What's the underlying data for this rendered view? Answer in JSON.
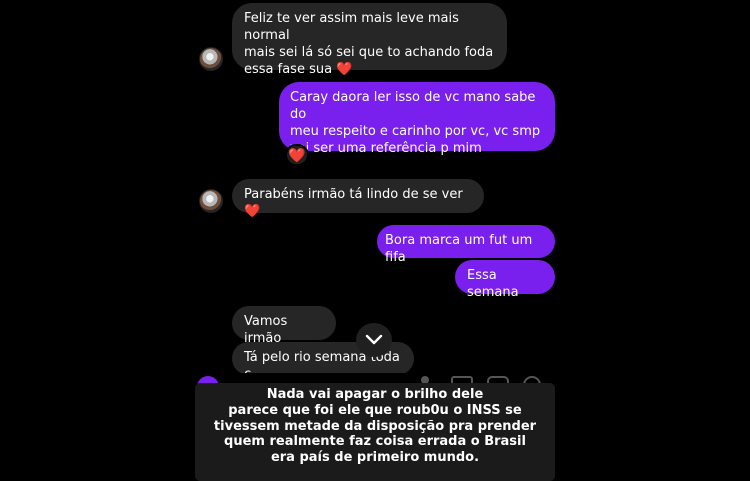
{
  "conversation": {
    "messages": [
      {
        "sender": "contact",
        "text": "Feliz te ver assim mais leve mais normal\nmais sei lá só sei que to achando foda\nessa fase sua ❤️"
      },
      {
        "sender": "me",
        "text": "Caray daora ler isso de vc mano sabe do\nmeu respeito e carinho por vc, vc smp\nvai ser uma referência p mim",
        "reaction": "❤️"
      },
      {
        "sender": "contact",
        "text": "Parabéns irmão tá lindo de se ver ❤️"
      },
      {
        "sender": "me",
        "text": "Bora marca um fut um fifa"
      },
      {
        "sender": "me",
        "text": "Essa semana"
      },
      {
        "sender": "contact",
        "text": "Vamos irmão"
      },
      {
        "sender": "contact",
        "text": "Tá pelo rio semana toda c"
      }
    ]
  },
  "icons": {
    "avatar": "contact-avatar",
    "reaction": "heart-reaction-icon",
    "scroll": "chevron-down-icon"
  },
  "caption": {
    "text": "Nada vai apagar o brilho dele\nparece que foi ele que roub0u o INSS se\ntivessem metade da disposição pra prender\nquem realmente faz coisa errada o Brasil\nera país de primeiro mundo."
  },
  "colors": {
    "background": "#000000",
    "incoming_bubble": "#262626",
    "outgoing_bubble": "#7a20ee",
    "caption_background": "#1b1b1b",
    "heart": "#ff2d45"
  }
}
